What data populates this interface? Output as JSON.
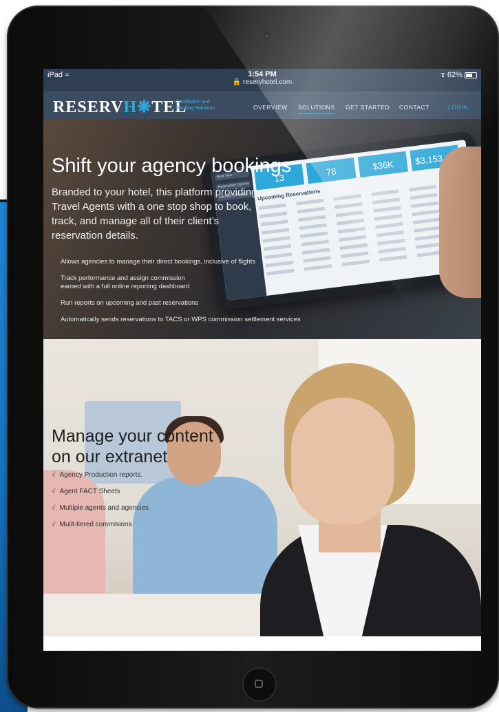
{
  "status_bar": {
    "device": "iPad",
    "time": "1:54 PM",
    "url": "reservhotel.com",
    "battery": "62%",
    "battery_level": 0.62
  },
  "brand": {
    "logo_part1": "RESERV",
    "logo_part2": "H",
    "logo_part3": "TEL",
    "tagline_line1": "Distribution and",
    "tagline_line2": "Booking Solutions",
    "accent_color": "#2ea8d8",
    "nav_color": "#3b4c61"
  },
  "nav": {
    "items": [
      "OVERVIEW",
      "SOLUTIONS",
      "GET STARTED",
      "CONTACT",
      "LOGIN"
    ],
    "active": "SOLUTIONS"
  },
  "hero": {
    "title": "Shift your agency bookings",
    "subtitle": "Branded to your hotel, this platform providing Travel Agents with a one stop shop to book, track, and manage all of their client’s reservation details.",
    "bullets": [
      "Allows agencies to manage their direct bookings, inclusive of flights",
      "Track performance and assign commission",
      "earned with a full online reporting dashboard",
      "Run reports on upcoming and past reservations",
      "Automatically sends reservations to TACS or WPS commission settlement services"
    ],
    "tablet": {
      "stats": [
        "13",
        "78",
        "$36K",
        "$3,153.48"
      ],
      "section_title": "Upcoming Reservations",
      "menu": [
        "Book Now",
        "Reservation Options",
        "Member Services"
      ]
    }
  },
  "extranet": {
    "title_line1": "Manage your content",
    "title_line2": "on our extranet",
    "check_glyph": "√",
    "items": [
      "Agency Production reports.",
      "Agent FACT Sheets",
      "Multiple agents and agencies",
      "Mulit-tiered commisions"
    ]
  },
  "icons": {
    "wifi": "wifi-icon",
    "lock": "lock-icon",
    "bluetooth": "bluetooth-icon",
    "battery": "battery-icon",
    "home": "home-button-icon"
  }
}
